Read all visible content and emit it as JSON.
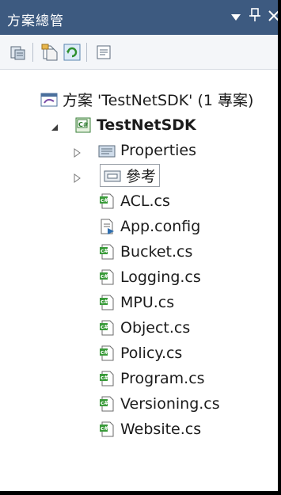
{
  "panel": {
    "title": "方案總管",
    "dropdown_icon": "triangle-down-icon",
    "pin_icon": "pin-icon",
    "close_icon": "close-icon"
  },
  "toolbar": {
    "buttons": [
      "properties-icon",
      "show-all-files-icon",
      "refresh-icon",
      "view-class-diagram-icon"
    ]
  },
  "tree": {
    "solution": {
      "label": "方案 'TestNetSDK' (1 專案)"
    },
    "project": {
      "label": "TestNetSDK"
    },
    "items": [
      {
        "label": "Properties",
        "icon": "properties-folder-icon"
      },
      {
        "label": "參考",
        "icon": "references-folder-icon"
      },
      {
        "label": "ACL.cs",
        "icon": "csharp-file-icon"
      },
      {
        "label": "App.config",
        "icon": "config-file-icon"
      },
      {
        "label": "Bucket.cs",
        "icon": "csharp-file-icon"
      },
      {
        "label": "Logging.cs",
        "icon": "csharp-file-icon"
      },
      {
        "label": "MPU.cs",
        "icon": "csharp-file-icon"
      },
      {
        "label": "Object.cs",
        "icon": "csharp-file-icon"
      },
      {
        "label": "Policy.cs",
        "icon": "csharp-file-icon"
      },
      {
        "label": "Program.cs",
        "icon": "csharp-file-icon"
      },
      {
        "label": "Versioning.cs",
        "icon": "csharp-file-icon"
      },
      {
        "label": "Website.cs",
        "icon": "csharp-file-icon"
      }
    ]
  },
  "colors": {
    "titlebar": "#3d5a80",
    "toolbar": "#f4f6f9",
    "cs_icon_green": "#3a9b3a"
  }
}
